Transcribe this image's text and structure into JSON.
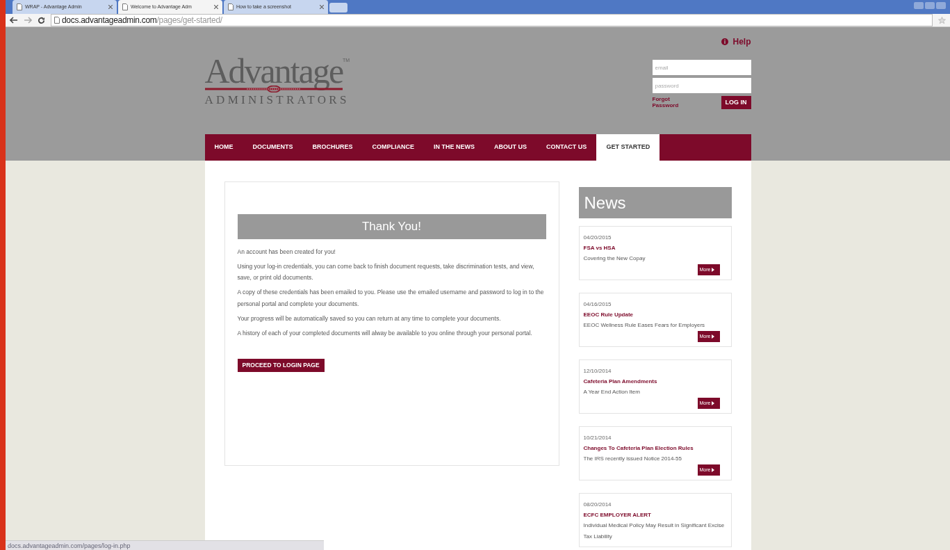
{
  "browser": {
    "tabs": [
      {
        "label": "WRAP - Advantage Admin",
        "selected": false
      },
      {
        "label": "Welcome to Advantage Adm",
        "selected": true
      },
      {
        "label": "How to take a screenshot",
        "selected": false
      }
    ],
    "address": {
      "host": "docs.advantageadmin.com",
      "path": "/pages/get-started/"
    },
    "status_url": "docs.advantageadmin.com/pages/log-in.php"
  },
  "header": {
    "help": "Help",
    "logo": {
      "name": "Advantage",
      "tm": "TM",
      "subtitle": "ADMINISTRATORS"
    },
    "login": {
      "email_placeholder": "email",
      "password_placeholder": "password",
      "forgot": "Forgot Password",
      "button": "LOG IN"
    }
  },
  "nav": [
    {
      "label": "HOME",
      "selected": false
    },
    {
      "label": "DOCUMENTS",
      "selected": false
    },
    {
      "label": "BROCHURES",
      "selected": false
    },
    {
      "label": "COMPLIANCE",
      "selected": false
    },
    {
      "label": "IN THE NEWS",
      "selected": false
    },
    {
      "label": "ABOUT US",
      "selected": false
    },
    {
      "label": "CONTACT US",
      "selected": false
    },
    {
      "label": "GET STARTED",
      "selected": true
    }
  ],
  "main": {
    "title": "Thank You!",
    "paragraphs": [
      "An account has been created for you!",
      "Using your log-in credentials, you can come back to finish document requests, take discrimination tests, and view, save, or print old documents.",
      "A copy of these credentials has been emailed to you. Please use the emailed username and password to log in to the personal portal and complete your documents.",
      "Your progress will be automatically saved so you can return at any time to complete your documents.",
      "A history of each of your completed documents will alway be available to you online through your personal portal."
    ],
    "button": "PROCEED TO LOGIN PAGE"
  },
  "news": {
    "title": "News",
    "items": [
      {
        "date": "04/20/2015",
        "title": "FSA vs HSA",
        "summary": "Covering the New Copay",
        "more": "More"
      },
      {
        "date": "04/16/2015",
        "title": "EEOC Rule Update",
        "summary": "EEOC Wellness Rule Eases Fears for Employers",
        "more": "More"
      },
      {
        "date": "12/10/2014",
        "title": "Cafeteria Plan Amendments",
        "summary": "A Year End Action Item",
        "more": "More"
      },
      {
        "date": "10/21/2014",
        "title": "Changes To Cafeteria Plan Election Rules",
        "summary": "The IRS recently issued Notice 2014-55",
        "more": "More"
      },
      {
        "date": "08/20/2014",
        "title": "ECFC EMPLOYER ALERT",
        "summary": "Individual Medical Policy May Result in Significant Excise Tax Liability"
      }
    ]
  }
}
